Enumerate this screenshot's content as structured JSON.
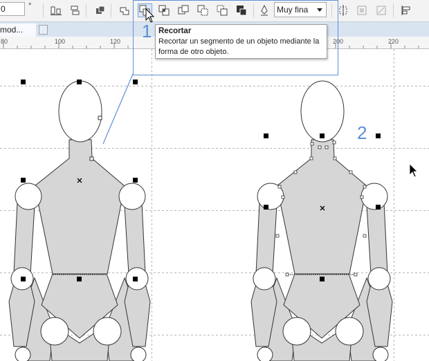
{
  "toolbar": {
    "angle_value": "0",
    "degree_symbol": "°",
    "outline_width": "Muy fina"
  },
  "tab_bar": {
    "document_tab": "mod..."
  },
  "ruler": {
    "labels": [
      "80",
      "100",
      "120",
      "200",
      "220"
    ]
  },
  "tooltip": {
    "title": "Recortar",
    "description": "Recortar un segmento de un objeto mediante la forma de otro objeto."
  },
  "annotations": {
    "step1": "1",
    "step2": "2"
  },
  "colors": {
    "figure_fill": "#d6d6d6",
    "highlight": "#5f8fd6",
    "tab_bar": "#d9e4f1"
  }
}
